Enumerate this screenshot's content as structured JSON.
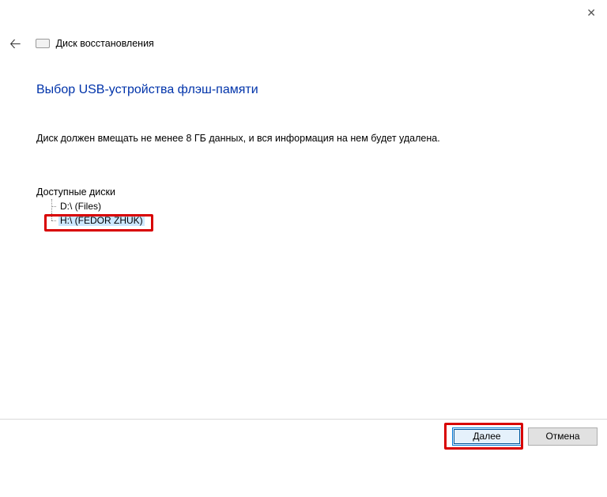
{
  "window": {
    "title": "Диск восстановления"
  },
  "page": {
    "heading": "Выбор USB-устройства флэш-памяти",
    "instruction": "Диск должен вмещать не менее 8 ГБ данных, и вся информация на нем будет удалена."
  },
  "drives": {
    "label": "Доступные диски",
    "items": [
      {
        "text": "D:\\ (Files)",
        "selected": false
      },
      {
        "text": "H:\\ (FEDOR ZHUK)",
        "selected": true
      }
    ]
  },
  "buttons": {
    "next": "Далее",
    "cancel": "Отмена"
  }
}
